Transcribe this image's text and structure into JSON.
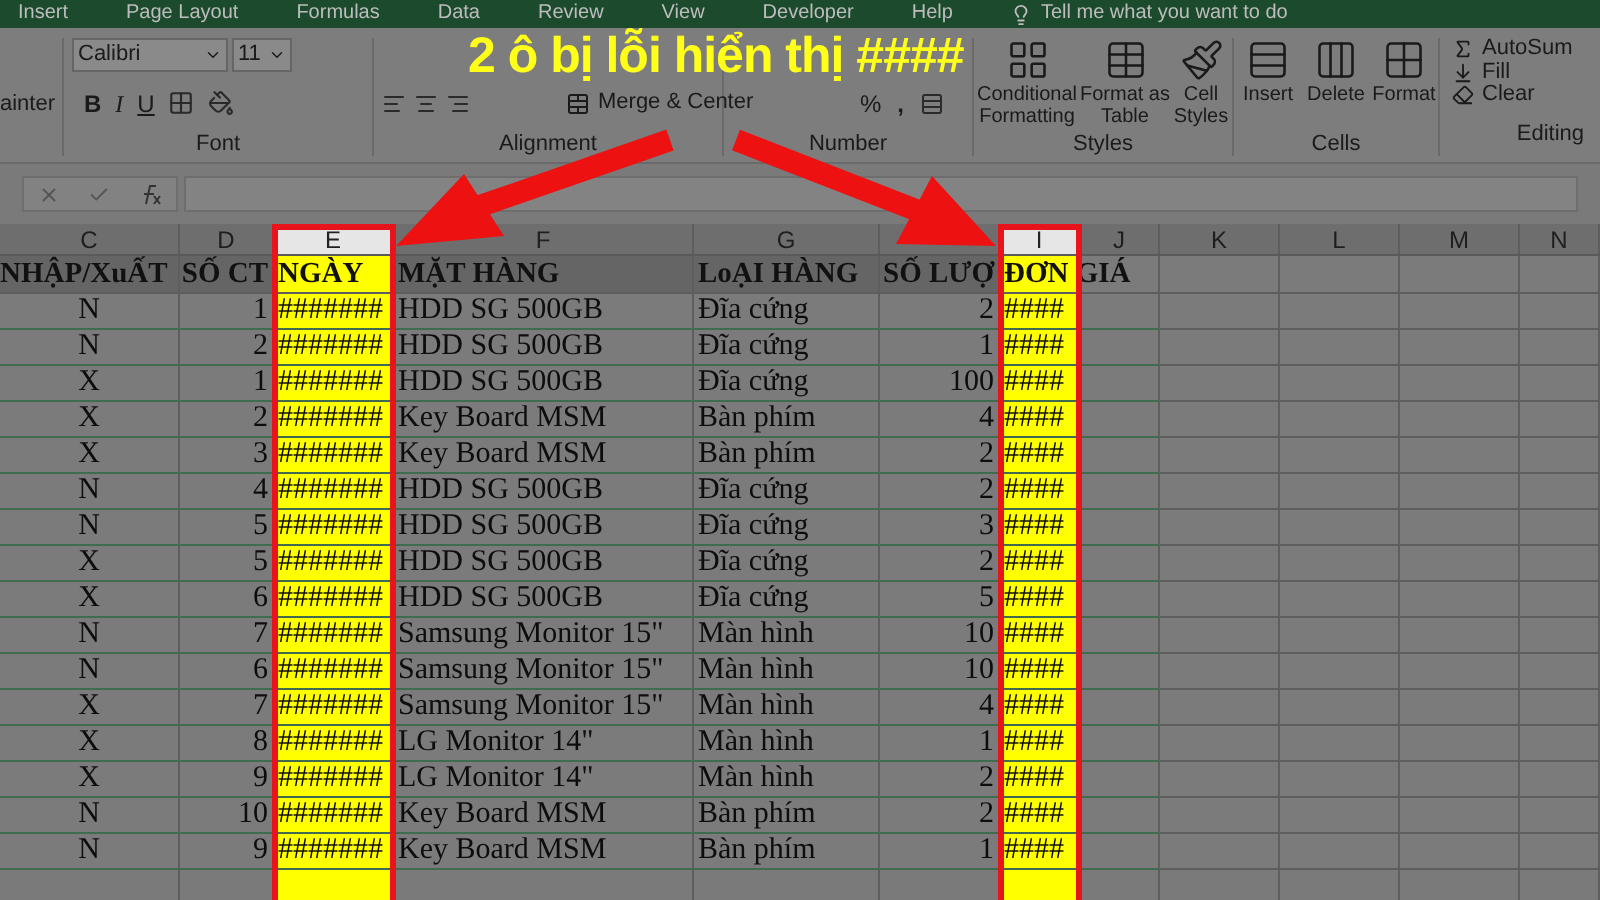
{
  "ribbon_tabs": [
    "Insert",
    "Page Layout",
    "Formulas",
    "Data",
    "Review",
    "View",
    "Developer",
    "Help"
  ],
  "tell_me": "Tell me what you want to do",
  "ribbon": {
    "clipboard_partial": "ainter",
    "font": {
      "name": "Calibri",
      "size": "11",
      "bold": "B",
      "italic": "I",
      "underline": "U",
      "label": "Font"
    },
    "alignment": {
      "merge": "Merge & Center",
      "label": "Alignment"
    },
    "number": {
      "percent": "%",
      "comma": ",",
      "label": "Number"
    },
    "styles": {
      "buttons": [
        "Conditional Formatting",
        "Format as Table",
        "Cell Styles"
      ],
      "label": "Styles"
    },
    "cells": {
      "buttons": [
        "Insert",
        "Delete",
        "Format"
      ],
      "label": "Cells"
    },
    "editing": {
      "buttons": [
        "AutoSum",
        "Fill",
        "Clear"
      ],
      "label": "Editing"
    }
  },
  "columns": [
    {
      "label": "C",
      "highlighted": false
    },
    {
      "label": "D",
      "highlighted": false
    },
    {
      "label": "E",
      "highlighted": true
    },
    {
      "label": "F",
      "highlighted": false
    },
    {
      "label": "G",
      "highlighted": false
    },
    {
      "highlighted": false
    },
    {
      "label": "I",
      "highlighted": true
    },
    {
      "label": "J",
      "highlighted": false
    },
    {
      "label": "K",
      "highlighted": false
    },
    {
      "label": "L",
      "highlighted": false
    },
    {
      "label": "M",
      "highlighted": false
    },
    {
      "label": "N",
      "highlighted": false
    }
  ],
  "header_row": [
    "NHẬP/XuẤT",
    "SỐ CT",
    "NGÀY",
    "MẶT HÀNG",
    "LoẠI HÀNG",
    "SỐ LƯỢ",
    "ĐƠN GIÁ"
  ],
  "rows": [
    [
      "N",
      "1",
      "#######",
      "HDD SG 500GB",
      "Đĩa cứng",
      "2",
      "####"
    ],
    [
      "N",
      "2",
      "#######",
      "HDD SG 500GB",
      "Đĩa cứng",
      "1",
      "####"
    ],
    [
      "X",
      "1",
      "#######",
      "HDD SG 500GB",
      "Đĩa cứng",
      "100",
      "####"
    ],
    [
      "X",
      "2",
      "#######",
      "Key Board MSM",
      "Bàn phím",
      "4",
      "####"
    ],
    [
      "X",
      "3",
      "#######",
      "Key Board MSM",
      "Bàn phím",
      "2",
      "####"
    ],
    [
      "N",
      "4",
      "#######",
      "HDD SG 500GB",
      "Đĩa cứng",
      "2",
      "####"
    ],
    [
      "N",
      "5",
      "#######",
      "HDD SG 500GB",
      "Đĩa cứng",
      "3",
      "####"
    ],
    [
      "X",
      "5",
      "#######",
      "HDD SG 500GB",
      "Đĩa cứng",
      "2",
      "####"
    ],
    [
      "X",
      "6",
      "#######",
      "HDD SG 500GB",
      "Đĩa cứng",
      "5",
      "####"
    ],
    [
      "N",
      "7",
      "#######",
      "Samsung Monitor 15\"",
      "Màn hình",
      "10",
      "####"
    ],
    [
      "N",
      "6",
      "#######",
      "Samsung Monitor 15\"",
      "Màn hình",
      "10",
      "####"
    ],
    [
      "X",
      "7",
      "#######",
      "Samsung Monitor 15\"",
      "Màn hình",
      "4",
      "####"
    ],
    [
      "X",
      "8",
      "#######",
      "LG Monitor 14\"",
      "Màn hình",
      "1",
      "####"
    ],
    [
      "X",
      "9",
      "#######",
      "LG Monitor 14\"",
      "Màn hình",
      "2",
      "####"
    ],
    [
      "N",
      "10",
      "#######",
      "Key Board MSM",
      "Bàn phím",
      "2",
      "####"
    ],
    [
      "N",
      "9",
      "#######",
      "Key Board MSM",
      "Bàn phím",
      "1",
      "####"
    ]
  ],
  "callout": {
    "text": "2 ô bị lỗi hiển thị ####"
  }
}
